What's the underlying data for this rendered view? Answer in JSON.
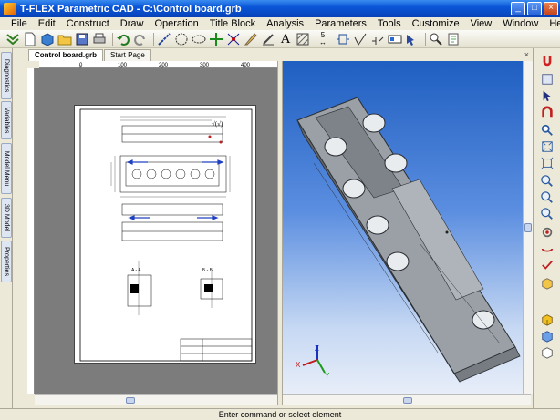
{
  "window": {
    "title": "T-FLEX Parametric CAD - C:\\Control board.grb"
  },
  "menu": [
    "File",
    "Edit",
    "Construct",
    "Draw",
    "Operation",
    "Title Block",
    "Analysis",
    "Parameters",
    "Tools",
    "Customize",
    "View",
    "Window",
    "Help"
  ],
  "toolbar": {
    "icons": [
      "checkmark-icon",
      "new-document-icon",
      "3d-box-icon",
      "open-folder-icon",
      "save-icon",
      "print-icon",
      "undo-icon",
      "redo-icon",
      "line-icon",
      "circle-icon",
      "ellipse-icon",
      "node-icon",
      "axis-icon",
      "sketch-icon",
      "edit-pen-icon",
      "text-icon",
      "hatch-icon",
      "dimension-icon",
      "fragment-icon",
      "roughness-icon",
      "tolerance-icon",
      "view-icon",
      "zoom-icon",
      "document-params-icon"
    ],
    "text_icon_glyph": "A",
    "dimension_value": "5"
  },
  "left_tabs": [
    "Diagnostics",
    "Variables",
    "Model Menu",
    "3D Model",
    "Properties"
  ],
  "doc_tabs": [
    {
      "label": "Control board.grb",
      "active": true
    },
    {
      "label": "Start Page",
      "active": false
    }
  ],
  "ruler_labels": [
    "0",
    "100",
    "200",
    "300",
    "400"
  ],
  "drawing": {
    "section_labels": [
      "A - A",
      "Б - Б"
    ],
    "roughness_mark": "√(√)"
  },
  "right_toolbar": [
    "magnet-icon",
    "tools-icon",
    "arrow-icon",
    "horseshoe-icon",
    "zoom-window-icon",
    "zoom-fit-icon",
    "zoom-extents-icon",
    "zoom-in-icon",
    "zoom-out-icon",
    "pan-icon",
    "rotate-icon",
    "orbit-icon",
    "select-check-icon",
    "view-cube-icon",
    "shaded-icon",
    "wire-icon",
    "cube-icon"
  ],
  "axes": {
    "x": "X",
    "y": "Y",
    "z": "Z"
  },
  "status": {
    "text": "Enter command or select element"
  },
  "colors": {
    "title_bar": "#0a56d8",
    "view_bg_top": "#1f5fc1",
    "part": "#8d9399"
  }
}
